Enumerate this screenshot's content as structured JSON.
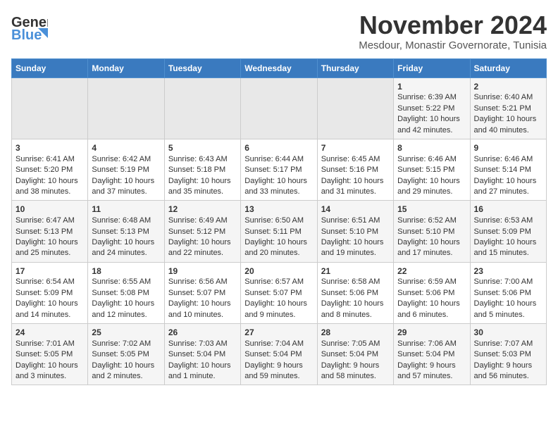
{
  "header": {
    "logo_line1": "General",
    "logo_line2": "Blue",
    "title": "November 2024",
    "subtitle": "Mesdour, Monastir Governorate, Tunisia"
  },
  "calendar": {
    "days_of_week": [
      "Sunday",
      "Monday",
      "Tuesday",
      "Wednesday",
      "Thursday",
      "Friday",
      "Saturday"
    ],
    "weeks": [
      [
        {
          "day": "",
          "empty": true
        },
        {
          "day": "",
          "empty": true
        },
        {
          "day": "",
          "empty": true
        },
        {
          "day": "",
          "empty": true
        },
        {
          "day": "",
          "empty": true
        },
        {
          "day": "1",
          "sunrise": "Sunrise: 6:39 AM",
          "sunset": "Sunset: 5:22 PM",
          "daylight": "Daylight: 10 hours and 42 minutes."
        },
        {
          "day": "2",
          "sunrise": "Sunrise: 6:40 AM",
          "sunset": "Sunset: 5:21 PM",
          "daylight": "Daylight: 10 hours and 40 minutes."
        }
      ],
      [
        {
          "day": "3",
          "sunrise": "Sunrise: 6:41 AM",
          "sunset": "Sunset: 5:20 PM",
          "daylight": "Daylight: 10 hours and 38 minutes."
        },
        {
          "day": "4",
          "sunrise": "Sunrise: 6:42 AM",
          "sunset": "Sunset: 5:19 PM",
          "daylight": "Daylight: 10 hours and 37 minutes."
        },
        {
          "day": "5",
          "sunrise": "Sunrise: 6:43 AM",
          "sunset": "Sunset: 5:18 PM",
          "daylight": "Daylight: 10 hours and 35 minutes."
        },
        {
          "day": "6",
          "sunrise": "Sunrise: 6:44 AM",
          "sunset": "Sunset: 5:17 PM",
          "daylight": "Daylight: 10 hours and 33 minutes."
        },
        {
          "day": "7",
          "sunrise": "Sunrise: 6:45 AM",
          "sunset": "Sunset: 5:16 PM",
          "daylight": "Daylight: 10 hours and 31 minutes."
        },
        {
          "day": "8",
          "sunrise": "Sunrise: 6:46 AM",
          "sunset": "Sunset: 5:15 PM",
          "daylight": "Daylight: 10 hours and 29 minutes."
        },
        {
          "day": "9",
          "sunrise": "Sunrise: 6:46 AM",
          "sunset": "Sunset: 5:14 PM",
          "daylight": "Daylight: 10 hours and 27 minutes."
        }
      ],
      [
        {
          "day": "10",
          "sunrise": "Sunrise: 6:47 AM",
          "sunset": "Sunset: 5:13 PM",
          "daylight": "Daylight: 10 hours and 25 minutes."
        },
        {
          "day": "11",
          "sunrise": "Sunrise: 6:48 AM",
          "sunset": "Sunset: 5:13 PM",
          "daylight": "Daylight: 10 hours and 24 minutes."
        },
        {
          "day": "12",
          "sunrise": "Sunrise: 6:49 AM",
          "sunset": "Sunset: 5:12 PM",
          "daylight": "Daylight: 10 hours and 22 minutes."
        },
        {
          "day": "13",
          "sunrise": "Sunrise: 6:50 AM",
          "sunset": "Sunset: 5:11 PM",
          "daylight": "Daylight: 10 hours and 20 minutes."
        },
        {
          "day": "14",
          "sunrise": "Sunrise: 6:51 AM",
          "sunset": "Sunset: 5:10 PM",
          "daylight": "Daylight: 10 hours and 19 minutes."
        },
        {
          "day": "15",
          "sunrise": "Sunrise: 6:52 AM",
          "sunset": "Sunset: 5:10 PM",
          "daylight": "Daylight: 10 hours and 17 minutes."
        },
        {
          "day": "16",
          "sunrise": "Sunrise: 6:53 AM",
          "sunset": "Sunset: 5:09 PM",
          "daylight": "Daylight: 10 hours and 15 minutes."
        }
      ],
      [
        {
          "day": "17",
          "sunrise": "Sunrise: 6:54 AM",
          "sunset": "Sunset: 5:09 PM",
          "daylight": "Daylight: 10 hours and 14 minutes."
        },
        {
          "day": "18",
          "sunrise": "Sunrise: 6:55 AM",
          "sunset": "Sunset: 5:08 PM",
          "daylight": "Daylight: 10 hours and 12 minutes."
        },
        {
          "day": "19",
          "sunrise": "Sunrise: 6:56 AM",
          "sunset": "Sunset: 5:07 PM",
          "daylight": "Daylight: 10 hours and 10 minutes."
        },
        {
          "day": "20",
          "sunrise": "Sunrise: 6:57 AM",
          "sunset": "Sunset: 5:07 PM",
          "daylight": "Daylight: 10 hours and 9 minutes."
        },
        {
          "day": "21",
          "sunrise": "Sunrise: 6:58 AM",
          "sunset": "Sunset: 5:06 PM",
          "daylight": "Daylight: 10 hours and 8 minutes."
        },
        {
          "day": "22",
          "sunrise": "Sunrise: 6:59 AM",
          "sunset": "Sunset: 5:06 PM",
          "daylight": "Daylight: 10 hours and 6 minutes."
        },
        {
          "day": "23",
          "sunrise": "Sunrise: 7:00 AM",
          "sunset": "Sunset: 5:06 PM",
          "daylight": "Daylight: 10 hours and 5 minutes."
        }
      ],
      [
        {
          "day": "24",
          "sunrise": "Sunrise: 7:01 AM",
          "sunset": "Sunset: 5:05 PM",
          "daylight": "Daylight: 10 hours and 3 minutes."
        },
        {
          "day": "25",
          "sunrise": "Sunrise: 7:02 AM",
          "sunset": "Sunset: 5:05 PM",
          "daylight": "Daylight: 10 hours and 2 minutes."
        },
        {
          "day": "26",
          "sunrise": "Sunrise: 7:03 AM",
          "sunset": "Sunset: 5:04 PM",
          "daylight": "Daylight: 10 hours and 1 minute."
        },
        {
          "day": "27",
          "sunrise": "Sunrise: 7:04 AM",
          "sunset": "Sunset: 5:04 PM",
          "daylight": "Daylight: 9 hours and 59 minutes."
        },
        {
          "day": "28",
          "sunrise": "Sunrise: 7:05 AM",
          "sunset": "Sunset: 5:04 PM",
          "daylight": "Daylight: 9 hours and 58 minutes."
        },
        {
          "day": "29",
          "sunrise": "Sunrise: 7:06 AM",
          "sunset": "Sunset: 5:04 PM",
          "daylight": "Daylight: 9 hours and 57 minutes."
        },
        {
          "day": "30",
          "sunrise": "Sunrise: 7:07 AM",
          "sunset": "Sunset: 5:03 PM",
          "daylight": "Daylight: 9 hours and 56 minutes."
        }
      ]
    ]
  }
}
